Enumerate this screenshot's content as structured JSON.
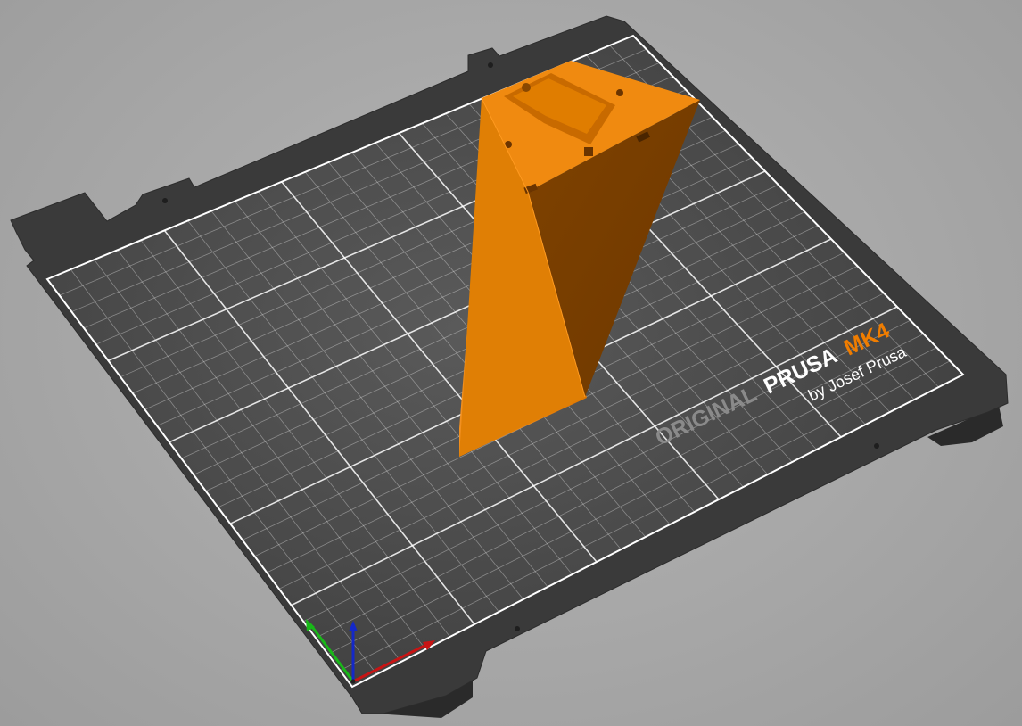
{
  "bed": {
    "brand_original": "ORIGINAL",
    "brand_prusa": "PRUSA",
    "brand_model": "MK4",
    "brand_byline": "by Josef Prusa"
  },
  "colors": {
    "background": "#a9a9a9",
    "bed_frame": "#3a3a3a",
    "bed_surface": "#4a4a4a",
    "grid_line": "#ffffff",
    "model_top": "#f08a10",
    "model_front": "#e07d00",
    "model_side": "#7a3f00",
    "axis_x": "#c81414",
    "axis_y": "#18b818",
    "axis_z": "#1428c8",
    "brand_accent": "#f07d00"
  },
  "axes": [
    {
      "name": "x-axis",
      "color": "#c81414"
    },
    {
      "name": "y-axis",
      "color": "#18b818"
    },
    {
      "name": "z-axis",
      "color": "#1428c8"
    }
  ]
}
